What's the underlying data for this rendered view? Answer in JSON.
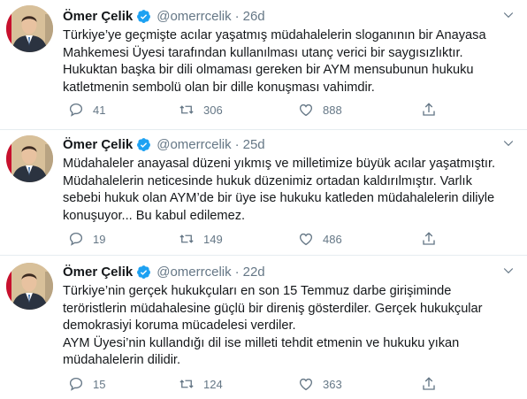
{
  "colors": {
    "text": "#14171a",
    "secondary": "#657786",
    "verified": "#1da1f2",
    "separator": "#e6ecf0"
  },
  "tweets": [
    {
      "name": "Ömer Çelik",
      "handle": "@omerrcelik",
      "dot": "·",
      "time": "26d",
      "text": "Türkiye’ye geçmişte acılar yaşatmış müdahalelerin sloganının bir Anayasa\nMahkemesi Üyesi tarafından kullanılması utanç verici bir saygısızlıktır.\nHukuktan başka bir dili olmaması gereken bir AYM mensubunun hukuku\nkatletmenin sembolü olan bir dille konuşması vahimdir.",
      "replies": "41",
      "retweets": "306",
      "likes": "888",
      "icons": [
        "reply-icon",
        "retweet-icon",
        "like-icon",
        "share-icon"
      ]
    },
    {
      "name": "Ömer Çelik",
      "handle": "@omerrcelik",
      "dot": "·",
      "time": "25d",
      "text": "Müdahaleler anayasal düzeni yıkmış ve milletimize büyük acılar yaşatmıştır.\nMüdahalelerin neticesinde hukuk düzenimiz ortadan kaldırılmıştır. Varlık\nsebebi hukuk olan AYM’de bir üye ise hukuku katleden müdahalelerin diliyle\nkonuşuyor... Bu kabul edilemez.",
      "replies": "19",
      "retweets": "149",
      "likes": "486",
      "icons": [
        "reply-icon",
        "retweet-icon",
        "like-icon",
        "share-icon"
      ]
    },
    {
      "name": "Ömer Çelik",
      "handle": "@omerrcelik",
      "dot": "·",
      "time": "22d",
      "text": "Türkiye’nin gerçek hukukçuları en son 15 Temmuz darbe girişiminde\nteröristlerin müdahalesine güçlü bir direniş gösterdiler. Gerçek hukukçular\ndemokrasiyi koruma mücadelesi verdiler.\nAYM Üyesi’nin kullandığı dil ise milleti tehdit etmenin ve hukuku yıkan\nmüdahalelerin dilidir.",
      "replies": "15",
      "retweets": "124",
      "likes": "363",
      "icons": [
        "reply-icon",
        "retweet-icon",
        "like-icon",
        "share-icon"
      ]
    }
  ]
}
